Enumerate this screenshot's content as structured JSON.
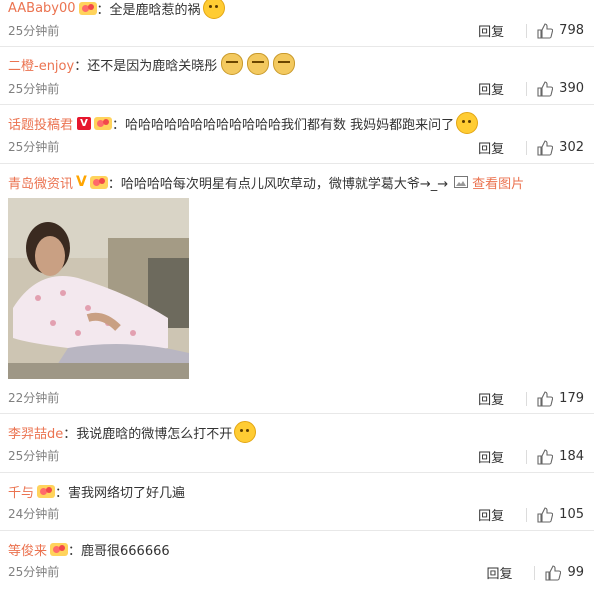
{
  "comments": [
    {
      "user": "AABaby00",
      "text": "：全是鹿晗惹的祸",
      "time": "25分钟前",
      "likes": "798"
    },
    {
      "user": "二橙-enjoy",
      "text": "：还不是因为鹿晗关晓彤",
      "time": "25分钟前",
      "likes": "390"
    },
    {
      "user": "话题投稿君",
      "text": "：哈哈哈哈哈哈哈哈哈哈哈哈我们都有数 我妈妈都跑来问了",
      "time": "25分钟前",
      "likes": "302"
    },
    {
      "user": "青岛微资讯",
      "text": "：哈哈哈哈每次明星有点儿风吹草动，微博就学葛大爷→_→",
      "view_image": "查看图片",
      "time": "22分钟前",
      "likes": "179"
    },
    {
      "user": "李羿喆de",
      "text": "：我说鹿晗的微博怎么打不开",
      "time": "25分钟前",
      "likes": "184"
    },
    {
      "user": "千与",
      "text": "：害我网络切了好几遍",
      "time": "24分钟前",
      "likes": "105"
    },
    {
      "user": "等俊来",
      "text": "：鹿哥很666666",
      "time": "25分钟前",
      "likes": "99"
    }
  ],
  "reply_label": "回复",
  "colors": {
    "username": "#eb7350",
    "divider": "#e8e8e8"
  }
}
